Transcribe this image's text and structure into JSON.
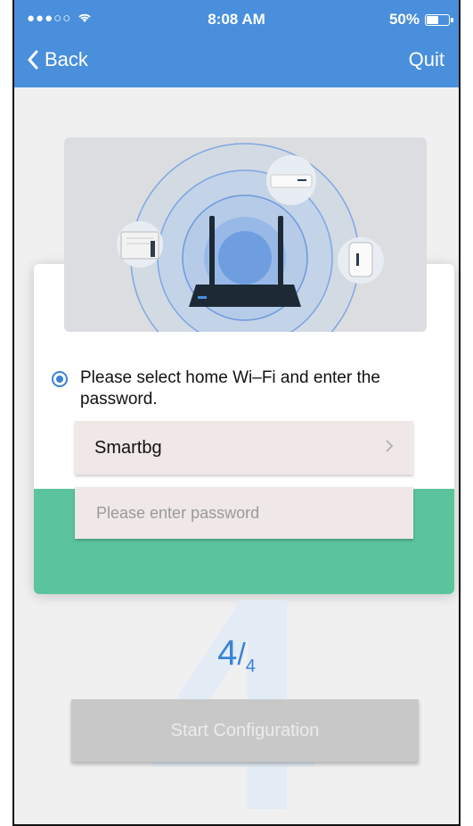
{
  "status": {
    "signal": "●●●○○",
    "time": "8:08 AM",
    "battery": "50%"
  },
  "nav": {
    "back_label": "Back",
    "quit_label": "Quit"
  },
  "option": {
    "text": "Please select home Wi–Fi and enter the password."
  },
  "wifi": {
    "ssid": "Smartbg",
    "password_placeholder": "Please enter password"
  },
  "step": {
    "current": "4",
    "total": "4",
    "background_numeral": "4"
  },
  "start_button": {
    "label": "Start Configuration"
  },
  "colors": {
    "accent": "#4a8fdb",
    "green": "#5cc49c",
    "radio": "#3a83d8"
  }
}
